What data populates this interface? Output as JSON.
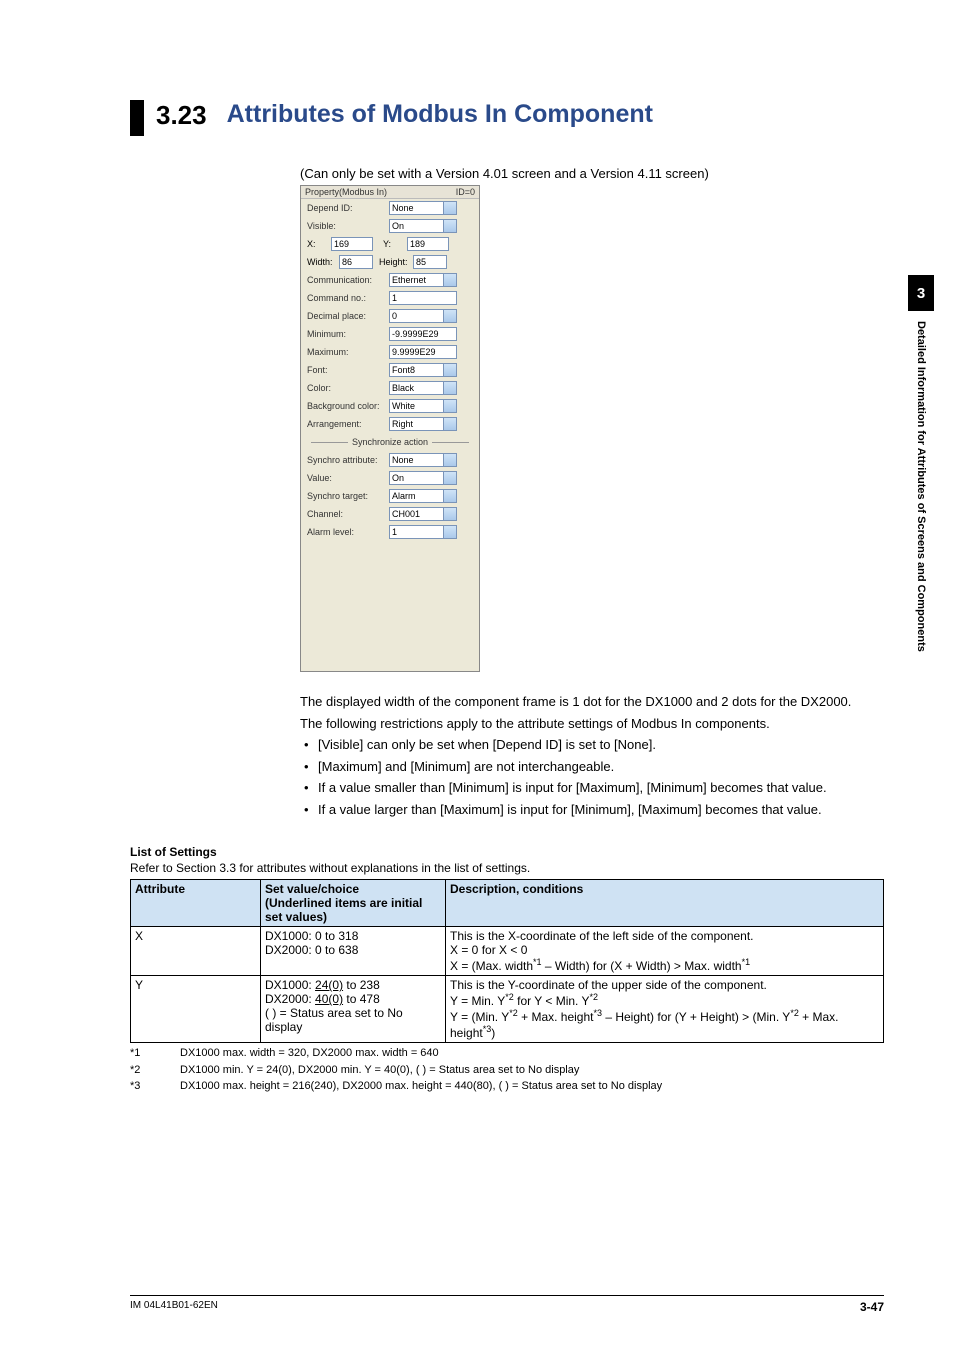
{
  "header": {
    "section_number": "3.23",
    "section_title": "Attributes of Modbus In Component",
    "version_note": "(Can only be set with a Version 4.01 screen and a Version 4.11 screen)"
  },
  "side_tab": {
    "chapter_num": "3",
    "chapter_label": "Detailed Information for Attributes of Screens and Components"
  },
  "property_panel": {
    "title_left": "Property(Modbus In)",
    "title_right": "ID=0",
    "rows": {
      "depend_id_label": "Depend ID:",
      "depend_id_value": "None",
      "visible_label": "Visible:",
      "visible_value": "On",
      "x_label": "X:",
      "x_value": "169",
      "y_label": "Y:",
      "y_value": "189",
      "width_label": "Width:",
      "width_value": "86",
      "height_label": "Height:",
      "height_value": "85",
      "comm_label": "Communication:",
      "comm_value": "Ethernet",
      "cmdno_label": "Command no.:",
      "cmdno_value": "1",
      "decplace_label": "Decimal place:",
      "decplace_value": "0",
      "min_label": "Minimum:",
      "min_value": "-9.9999E29",
      "max_label": "Maximum:",
      "max_value": "9.9999E29",
      "font_label": "Font:",
      "font_value": "Font8",
      "color_label": "Color:",
      "color_value": "Black",
      "bg_label": "Background color:",
      "bg_value": "White",
      "arr_label": "Arrangement:",
      "arr_value": "Right",
      "sync_divider": "Synchronize action",
      "syncattr_label": "Synchro attribute:",
      "syncattr_value": "None",
      "value_label": "Value:",
      "value_value": "On",
      "synctarget_label": "Synchro target:",
      "synctarget_value": "Alarm",
      "channel_label": "Channel:",
      "channel_value": "CH001",
      "alarmlvl_label": "Alarm level:",
      "alarmlvl_value": "1"
    }
  },
  "body": {
    "p1": "The displayed width of the component frame is 1 dot for the DX1000 and 2 dots for the DX2000.",
    "p2": "The following restrictions apply to the attribute settings of Modbus In components.",
    "bullets": [
      "[Visible] can only be set when [Depend ID] is set to [None].",
      "[Maximum] and [Minimum] are not interchangeable.",
      "If a value smaller than [Minimum] is input for [Maximum], [Minimum] becomes that value.",
      "If a value larger than [Maximum] is input for [Minimum], [Maximum] becomes that value."
    ]
  },
  "list_of_settings": {
    "heading": "List of Settings",
    "subheading": "Refer to Section 3.3 for attributes without explanations in the list of settings.",
    "headers": {
      "attr": "Attribute",
      "val": "Set value/choice",
      "val_note": "(Underlined items are initial set values)",
      "desc": "Description, conditions"
    },
    "rows": [
      {
        "attr": "X",
        "val_lines": [
          "DX1000: 0 to 318",
          "DX2000: 0 to 638"
        ],
        "desc_lines": [
          "This is the X-coordinate of the left side of the component.",
          "X = 0 for X < 0",
          "X = (Max. width*1 – Width) for (X + Width) > Max. width*1"
        ]
      },
      {
        "attr": "Y",
        "val_lines": [
          "DX1000: 24(0) to 238",
          "DX2000: 40(0) to 478",
          "(   ) = Status area set to No display"
        ],
        "desc_lines": [
          "This is the Y-coordinate of the upper side of the component.",
          "Y = Min. Y*2 for Y < Min. Y*2",
          "Y = (Min. Y*2 + Max. height*3 – Height) for (Y + Height) > (Min. Y*2 + Max. height*3)"
        ]
      }
    ]
  },
  "footnotes": [
    {
      "key": "*1",
      "text": "DX1000 max. width = 320, DX2000 max. width = 640"
    },
    {
      "key": "*2",
      "text": "DX1000 min. Y = 24(0), DX2000 min. Y = 40(0), (   ) = Status area set to No display"
    },
    {
      "key": "*3",
      "text": "DX1000 max. height = 216(240), DX2000 max. height = 440(80), (   ) = Status area set to No display"
    }
  ],
  "footer": {
    "doc_id": "IM 04L41B01-62EN",
    "page": "3-47"
  }
}
